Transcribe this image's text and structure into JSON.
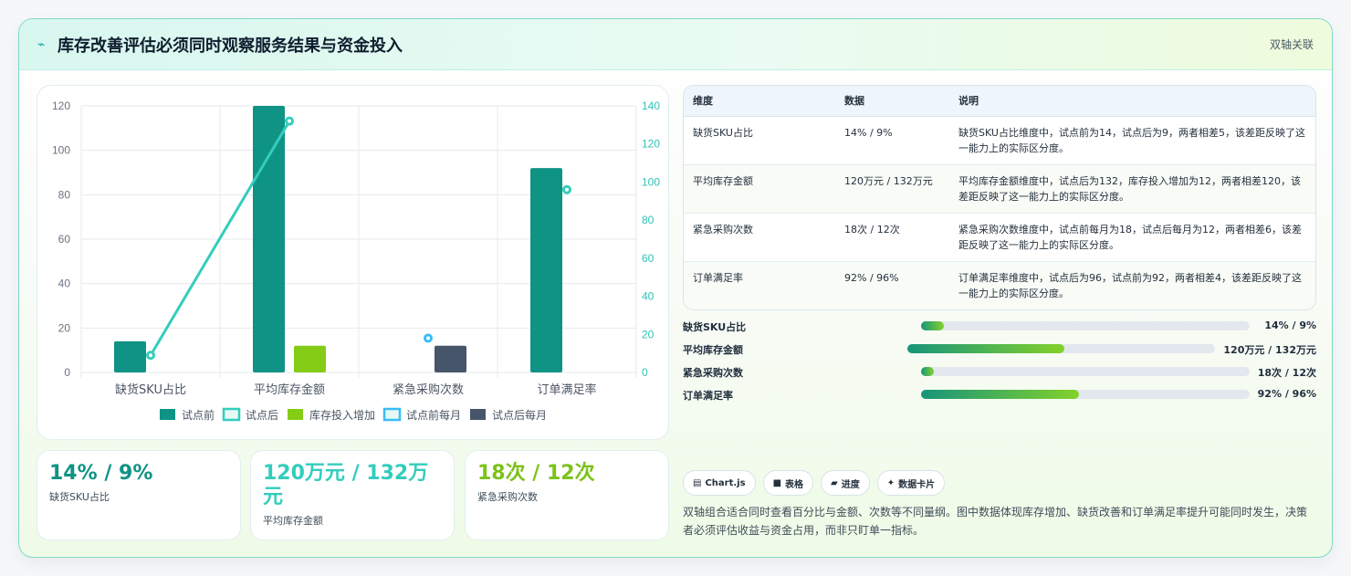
{
  "header": {
    "icon": "trend-icon",
    "title": "库存改善评估必须同时观察服务结果与资金投入",
    "tag": "双轴关联"
  },
  "chart_data": {
    "type": "bar",
    "categories": [
      "缺货SKU占比",
      "平均库存金额",
      "紧急采购次数",
      "订单满足率"
    ],
    "series": [
      {
        "name": "试点前",
        "kind": "bar",
        "axis": "left",
        "color": "#0f9384",
        "values": [
          14,
          120,
          null,
          92
        ]
      },
      {
        "name": "试点后",
        "kind": "line",
        "axis": "right",
        "color": "#33cdbc",
        "values": [
          9,
          132,
          null,
          96
        ]
      },
      {
        "name": "库存投入增加",
        "kind": "bar",
        "axis": "left",
        "color": "#84cc16",
        "values": [
          null,
          12,
          null,
          null
        ]
      },
      {
        "name": "试点前每月",
        "kind": "point",
        "axis": "right",
        "color": "#38bdf8",
        "values": [
          null,
          null,
          18,
          null
        ]
      },
      {
        "name": "试点后每月",
        "kind": "bar",
        "axis": "left",
        "color": "#465569",
        "values": [
          null,
          null,
          12,
          null
        ]
      }
    ],
    "yLeft": {
      "min": 0,
      "max": 120,
      "ticks": [
        0,
        20,
        40,
        60,
        80,
        100,
        120
      ]
    },
    "yRight": {
      "min": 0,
      "max": 140,
      "ticks": [
        0,
        20,
        40,
        60,
        80,
        100,
        120,
        140
      ]
    },
    "legend": "bottom",
    "grid": true
  },
  "stats": [
    {
      "value": "14% / 9%",
      "label": "缺货SKU占比",
      "color": "#0f9384"
    },
    {
      "value": "120万元 / 132万元",
      "label": "平均库存金额",
      "color": "#33cdbc"
    },
    {
      "value": "18次 / 12次",
      "label": "紧急采购次数",
      "color": "#7cc21a"
    }
  ],
  "table": {
    "headers": [
      "维度",
      "数据",
      "说明"
    ],
    "rows": [
      [
        "缺货SKU占比",
        "14% / 9%",
        "缺货SKU占比维度中，试点前为14，试点后为9，两者相差5，该差距反映了这一能力上的实际区分度。"
      ],
      [
        "平均库存金额",
        "120万元 / 132万元",
        "平均库存金额维度中，试点后为132，库存投入增加为12，两者相差120，该差距反映了这一能力上的实际区分度。"
      ],
      [
        "紧急采购次数",
        "18次 / 12次",
        "紧急采购次数维度中，试点前每月为18，试点后每月为12，两者相差6，该差距反映了这一能力上的实际区分度。"
      ],
      [
        "订单满足率",
        "92% / 96%",
        "订单满足率维度中，试点后为96，试点前为92，两者相差4，该差距反映了这一能力上的实际区分度。"
      ]
    ]
  },
  "progress": [
    {
      "label": "缺货SKU占比",
      "value": "14% / 9%",
      "fraction": 0.07
    },
    {
      "label": "平均库存金额",
      "value": "120万元 / 132万元",
      "fraction": 0.51
    },
    {
      "label": "紧急采购次数",
      "value": "18次 / 12次",
      "fraction": 0.04
    },
    {
      "label": "订单满足率",
      "value": "92% / 96%",
      "fraction": 0.48
    }
  ],
  "chips": [
    {
      "icon": "chart-icon",
      "glyph": "▤",
      "label": "Chart.js"
    },
    {
      "icon": "table-icon",
      "glyph": "■",
      "label": "表格"
    },
    {
      "icon": "progress-icon",
      "glyph": "▰",
      "label": "进度"
    },
    {
      "icon": "sparkle-icon",
      "glyph": "✦",
      "label": "数据卡片"
    }
  ],
  "note": "双轴组合适合同时查看百分比与金额、次数等不同量纲。图中数据体现库存增加、缺货改善和订单满足率提升可能同时发生，决策者必须评估收益与资金占用，而非只盯单一指标。"
}
